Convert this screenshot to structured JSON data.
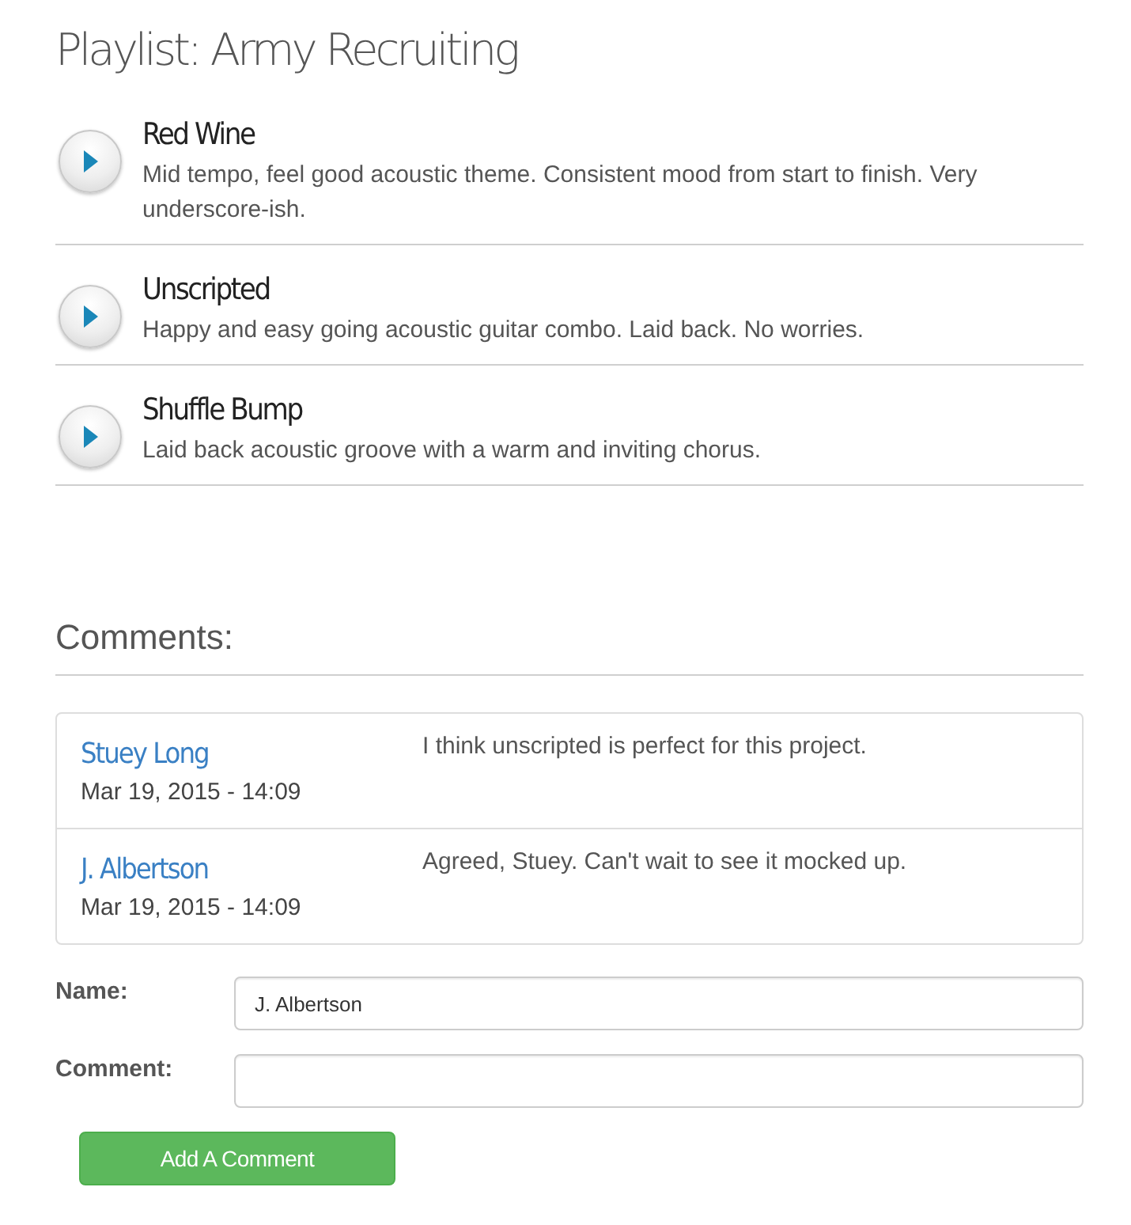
{
  "playlist": {
    "title": "Playlist: Army Recruiting",
    "tracks": [
      {
        "title": "Red Wine",
        "description": "Mid tempo, feel good acoustic theme. Consistent mood from start to finish. Very underscore-ish."
      },
      {
        "title": "Unscripted",
        "description": "Happy and easy going acoustic guitar combo. Laid back. No worries."
      },
      {
        "title": "Shuffle Bump",
        "description": "Laid back acoustic groove with a warm and inviting chorus."
      }
    ]
  },
  "comments": {
    "heading": "Comments:",
    "items": [
      {
        "author": "Stuey Long",
        "date": "Mar 19, 2015 - 14:09",
        "text": "I think unscripted is perfect for this project."
      },
      {
        "author": "J. Albertson",
        "date": "Mar 19, 2015 - 14:09",
        "text": "Agreed, Stuey. Can't wait to see it mocked up."
      }
    ]
  },
  "form": {
    "fields": [
      {
        "label": "Name:",
        "value": "J. Albertson"
      },
      {
        "label": "Comment:"
      }
    ],
    "submit": "Add A Comment"
  }
}
